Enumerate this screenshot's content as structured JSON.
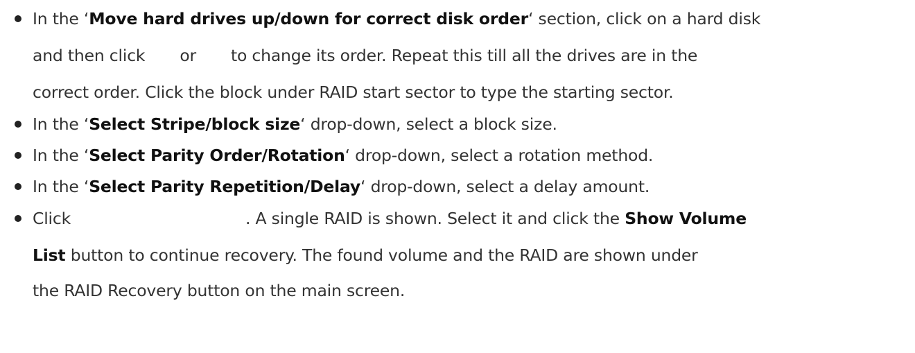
{
  "items": [
    {
      "l1_a": "In the ‘",
      "l1_b": "Move hard drives up/down for correct disk order",
      "l1_c": "‘ section, click on a hard disk",
      "l2_a": "and then click",
      "l2_b": "or",
      "l2_c": "to change its order. Repeat this till all the drives are in the",
      "l3": "correct order. Click the block under RAID start sector to type the starting sector."
    },
    {
      "a": "In the ‘",
      "b": "Select Stripe/block size",
      "c": "‘ drop-down, select a block size."
    },
    {
      "a": "In the ‘",
      "b": "Select Parity Order/Rotation",
      "c": "‘ drop-down, select a rotation method."
    },
    {
      "a": "In the ‘",
      "b": "Select Parity Repetition/Delay",
      "c": "‘ drop-down, select a delay amount."
    },
    {
      "l1_a": "Click",
      "l1_b": ". A single RAID is shown. Select it and click the",
      "l1_c": "Show Volume",
      "l2_a": "List",
      "l2_b": "button to continue recovery. The found volume and the RAID are shown under",
      "l3": "the RAID Recovery button on the main screen."
    }
  ]
}
